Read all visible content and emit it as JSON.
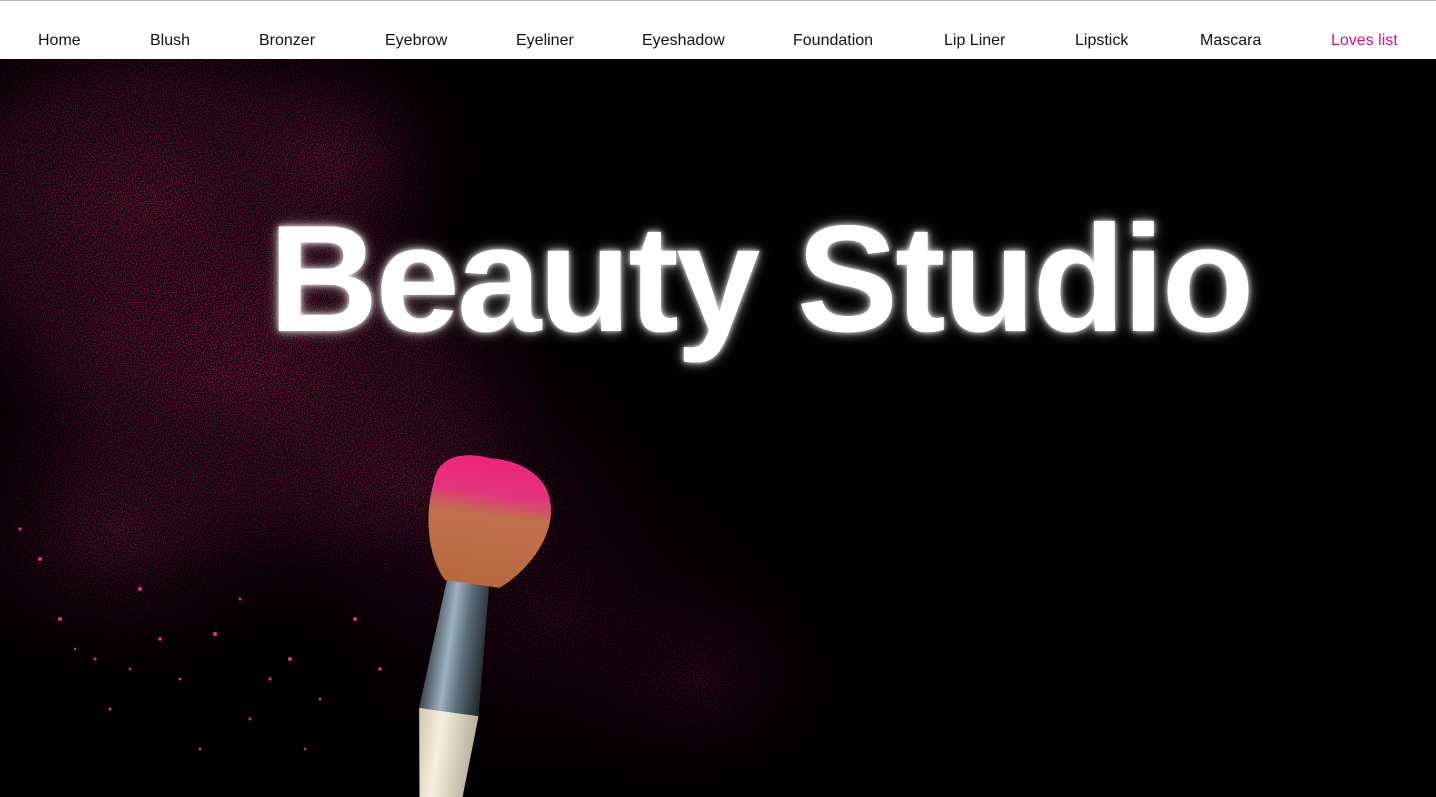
{
  "nav": {
    "items": [
      {
        "label": "Home"
      },
      {
        "label": "Blush"
      },
      {
        "label": "Bronzer"
      },
      {
        "label": "Eyebrow"
      },
      {
        "label": "Eyeliner"
      },
      {
        "label": "Eyeshadow"
      },
      {
        "label": "Foundation"
      },
      {
        "label": "Lip Liner"
      },
      {
        "label": "Lipstick"
      },
      {
        "label": "Mascara"
      },
      {
        "label": "Loves list"
      }
    ],
    "active_color": "#d4147a"
  },
  "hero": {
    "title": "Beauty Studio",
    "image_icon": "makeup-brush-powder-image",
    "background_color": "#000000",
    "powder_color": "#e0337f"
  }
}
